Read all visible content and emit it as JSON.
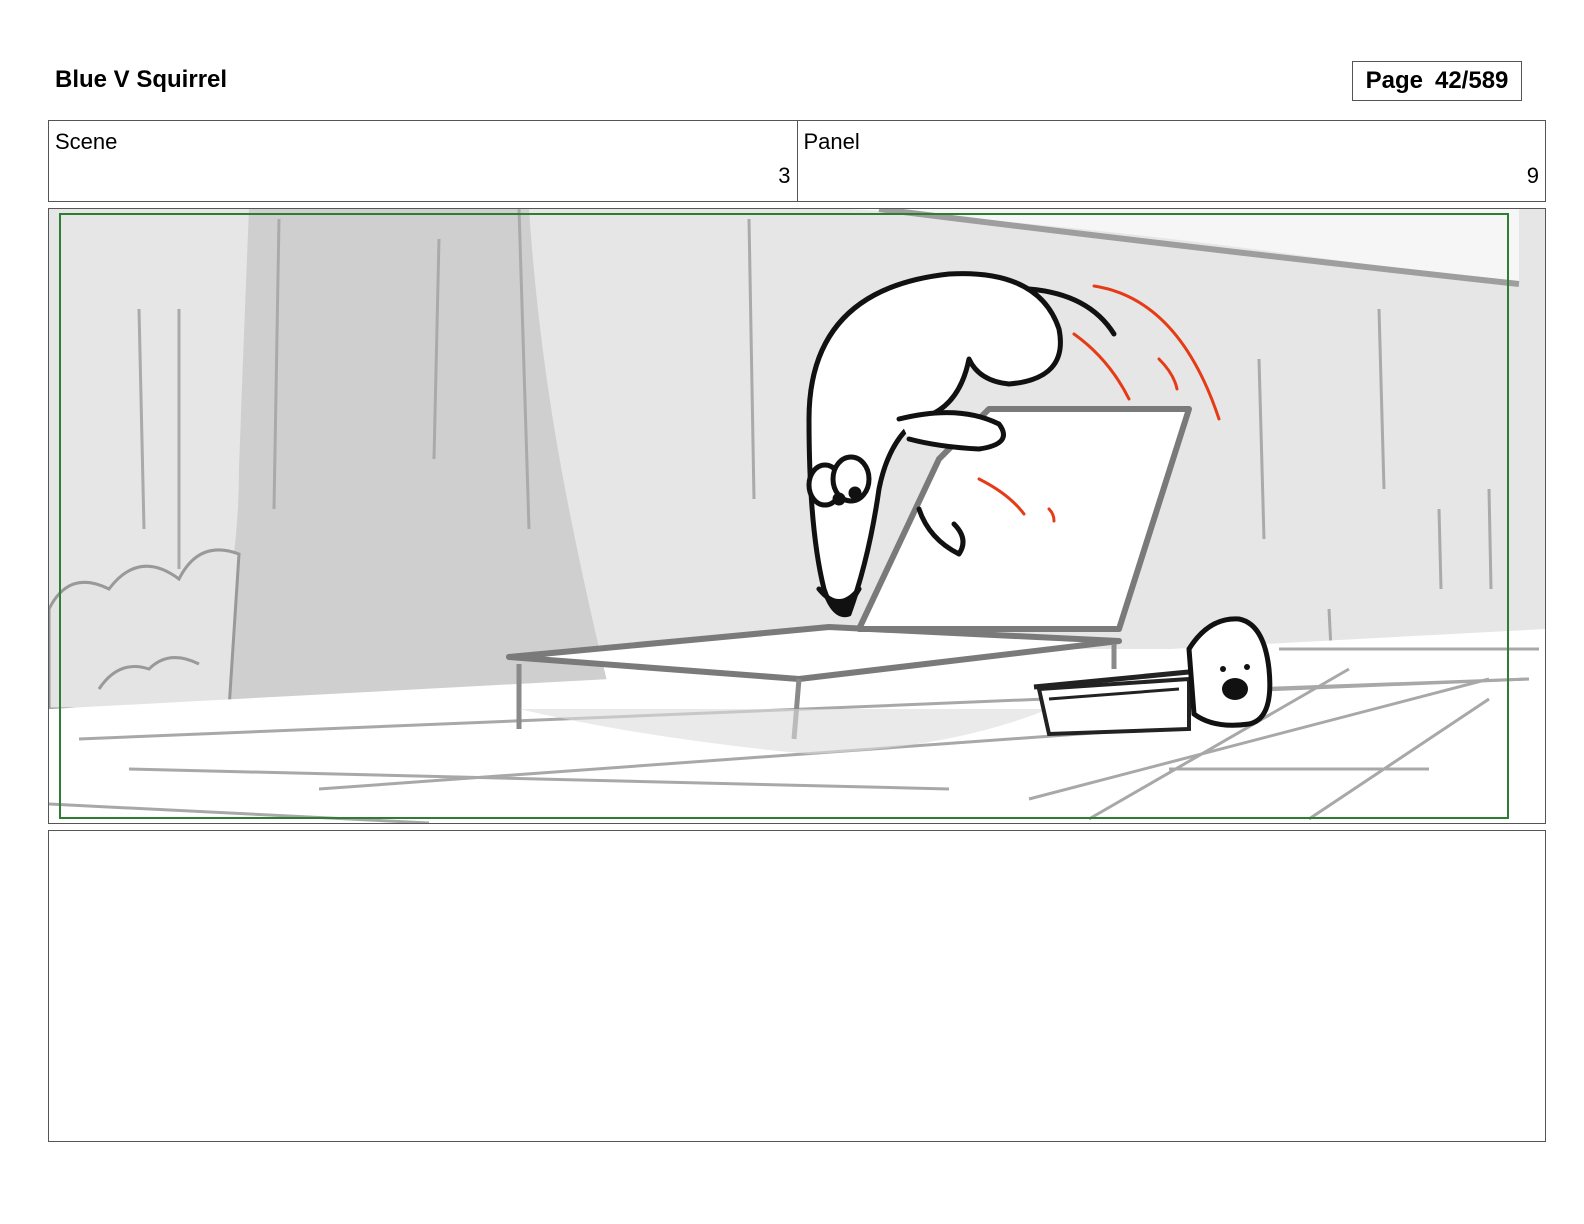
{
  "header": {
    "title": "Blue V Squirrel",
    "page_label": "Page",
    "page_number": "42/589"
  },
  "info": {
    "scene_label": "Scene",
    "scene_value": "3",
    "panel_label": "Panel",
    "panel_value": "9"
  },
  "notes": {
    "text": ""
  },
  "colors": {
    "safe_frame": "#2e7d32",
    "motion_lines": "#e53b17"
  }
}
